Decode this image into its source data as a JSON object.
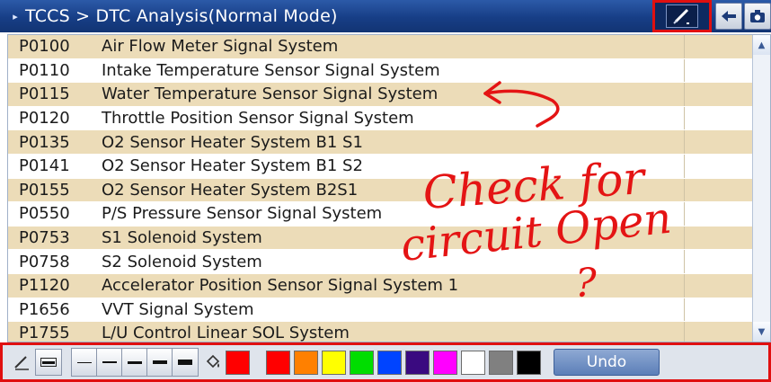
{
  "header": {
    "breadcrumb_arrow": "▸",
    "title": "TCCS > DTC Analysis(Normal Mode)"
  },
  "dtc_list": [
    {
      "code": "P0100",
      "description": "Air Flow Meter Signal System"
    },
    {
      "code": "P0110",
      "description": "Intake Temperature Sensor Signal System"
    },
    {
      "code": "P0115",
      "description": "Water Temperature Sensor Signal System"
    },
    {
      "code": "P0120",
      "description": "Throttle Position Sensor Signal System"
    },
    {
      "code": "P0135",
      "description": "O2 Sensor Heater System B1 S1"
    },
    {
      "code": "P0141",
      "description": "O2 Sensor Heater System B1 S2"
    },
    {
      "code": "P0155",
      "description": "O2 Sensor Heater System B2S1"
    },
    {
      "code": "P0550",
      "description": "P/S Pressure Sensor Signal System"
    },
    {
      "code": "P0753",
      "description": "S1 Solenoid System"
    },
    {
      "code": "P0758",
      "description": "S2 Solenoid System"
    },
    {
      "code": "P1120",
      "description": "Accelerator Position Sensor Signal System 1"
    },
    {
      "code": "P1656",
      "description": "VVT Signal System"
    },
    {
      "code": "P1755",
      "description": "L/U Control Linear SOL System"
    }
  ],
  "annotation": {
    "text_line1": "Check for",
    "text_line2": "circuit Open",
    "text_line3": "?"
  },
  "toolbar": {
    "current_color": "#ff0000",
    "swatches": [
      "#ff0000",
      "#ff8000",
      "#ffff00",
      "#00dd00",
      "#0044ff",
      "#3a0a80",
      "#ff00ff",
      "#ffffff",
      "#808080",
      "#000000"
    ],
    "undo_label": "Undo"
  },
  "icons": {
    "pen": "pen-icon",
    "back": "back-arrow-icon",
    "camera": "camera-icon",
    "fill": "paint-bucket-icon"
  }
}
